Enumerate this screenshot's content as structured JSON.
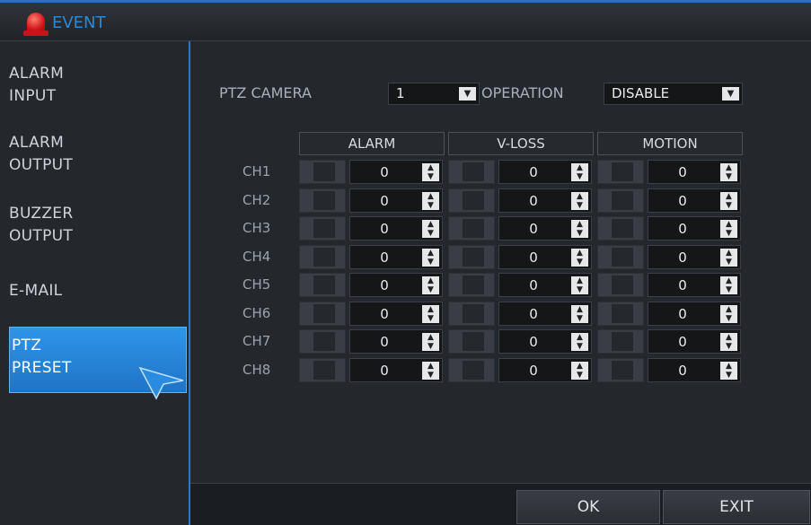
{
  "window": {
    "title": "EVENT",
    "title_icon": "siren-icon"
  },
  "sidebar": {
    "items": [
      {
        "line1": "ALARM",
        "line2": "INPUT"
      },
      {
        "line1": "ALARM",
        "line2": "OUTPUT"
      },
      {
        "line1": "BUZZER",
        "line2": "OUTPUT"
      },
      {
        "line1": "E-MAIL",
        "line2": ""
      },
      {
        "line1": "PTZ",
        "line2": "PRESET",
        "active": true
      }
    ]
  },
  "settings": {
    "ptz_camera_label": "PTZ CAMERA",
    "ptz_camera_value": "1",
    "operation_label": "OPERATION",
    "operation_value": "DISABLE"
  },
  "table": {
    "columns": [
      "ALARM",
      "V-LOSS",
      "MOTION"
    ],
    "rows": [
      {
        "ch": "CH1",
        "alarm": "0",
        "vloss": "0",
        "motion": "0"
      },
      {
        "ch": "CH2",
        "alarm": "0",
        "vloss": "0",
        "motion": "0"
      },
      {
        "ch": "CH3",
        "alarm": "0",
        "vloss": "0",
        "motion": "0"
      },
      {
        "ch": "CH4",
        "alarm": "0",
        "vloss": "0",
        "motion": "0"
      },
      {
        "ch": "CH5",
        "alarm": "0",
        "vloss": "0",
        "motion": "0"
      },
      {
        "ch": "CH6",
        "alarm": "0",
        "vloss": "0",
        "motion": "0"
      },
      {
        "ch": "CH7",
        "alarm": "0",
        "vloss": "0",
        "motion": "0"
      },
      {
        "ch": "CH8",
        "alarm": "0",
        "vloss": "0",
        "motion": "0"
      }
    ]
  },
  "buttons": {
    "ok": "OK",
    "exit": "EXIT"
  },
  "colors": {
    "accent": "#2f78c4",
    "title": "#2a89d6",
    "active_item": "#2e95e8"
  }
}
